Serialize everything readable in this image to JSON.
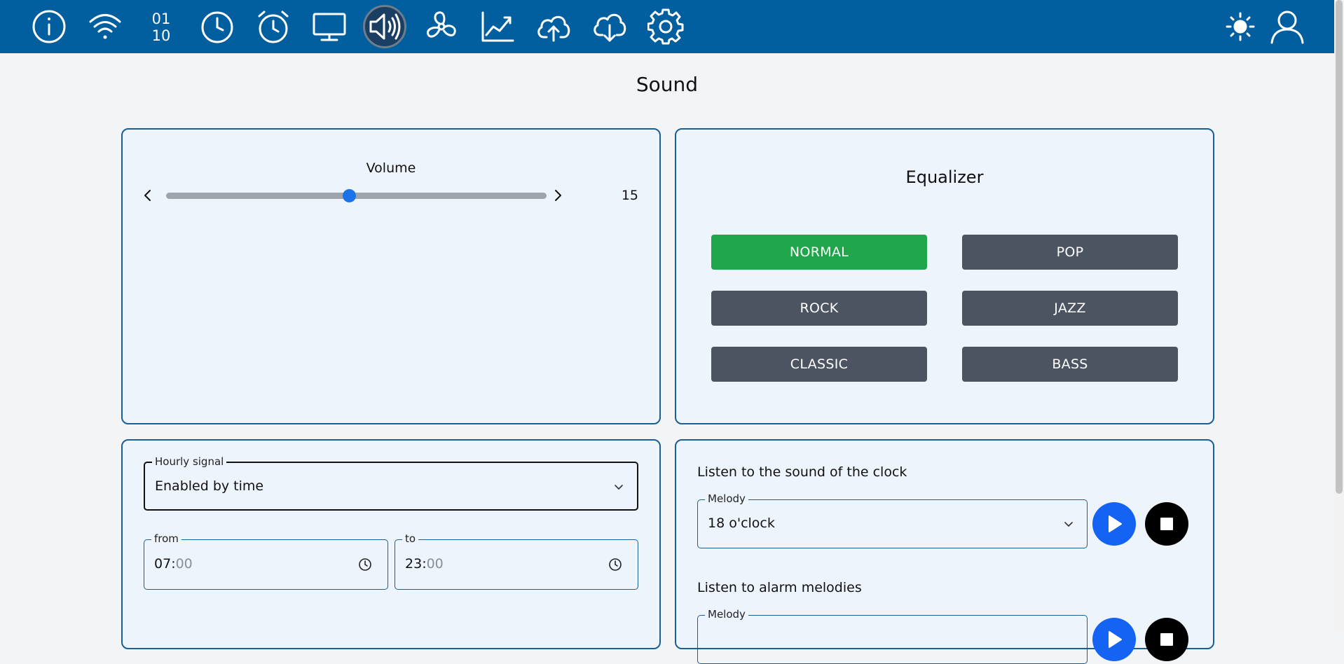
{
  "nav": {
    "items": [
      {
        "icon": "info-icon"
      },
      {
        "icon": "wifi-icon"
      },
      {
        "icon": "binary-icon",
        "text_top": "01",
        "text_bottom": "10"
      },
      {
        "icon": "clock-icon"
      },
      {
        "icon": "alarm-clock-icon"
      },
      {
        "icon": "monitor-icon"
      },
      {
        "icon": "speaker-icon",
        "active": true
      },
      {
        "icon": "fan-icon"
      },
      {
        "icon": "chart-line-icon"
      },
      {
        "icon": "cloud-upload-icon"
      },
      {
        "icon": "cloud-download-icon"
      },
      {
        "icon": "gear-icon"
      }
    ],
    "right": [
      {
        "icon": "brightness-icon"
      },
      {
        "icon": "user-icon"
      }
    ],
    "colors": {
      "bar": "#015fa0",
      "icon": "#ffffff"
    }
  },
  "page": {
    "title": "Sound"
  },
  "volume": {
    "label": "Volume",
    "value": "15",
    "fraction": 0.48,
    "accent": "#1a73e8"
  },
  "equalizer": {
    "title": "Equalizer",
    "presets": [
      "NORMAL",
      "POP",
      "ROCK",
      "JAZZ",
      "CLASSIC",
      "BASS"
    ],
    "selected": "NORMAL",
    "colors": {
      "selected": "#1fa54a",
      "default": "#4c5361"
    }
  },
  "hourly": {
    "legend": "Hourly signal",
    "value": "Enabled by time",
    "from": {
      "legend": "from",
      "hours": "07",
      "minutes": "00"
    },
    "to": {
      "legend": "to",
      "hours": "23",
      "minutes": "00"
    }
  },
  "clock_sound": {
    "label": "Listen to the sound of the clock",
    "melody_legend": "Melody",
    "melody_value": "18 o'clock"
  },
  "alarm_melodies": {
    "label": "Listen to alarm melodies",
    "melody_legend": "Melody"
  },
  "controls": {
    "play_color": "#1463f3",
    "stop_color": "#000000"
  }
}
